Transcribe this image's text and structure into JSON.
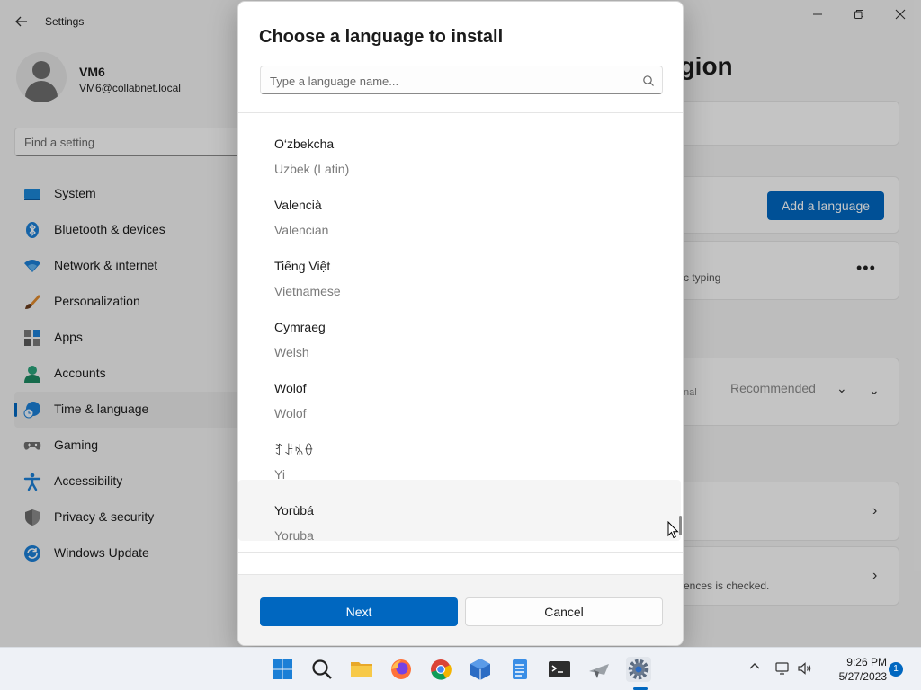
{
  "window": {
    "title": "Settings"
  },
  "profile": {
    "name": "VM6",
    "email": "VM6@collabnet.local"
  },
  "search": {
    "placeholder": "Find a setting"
  },
  "sidebar": {
    "items": [
      {
        "label": "System",
        "icon": "system-icon"
      },
      {
        "label": "Bluetooth & devices",
        "icon": "bluetooth-icon"
      },
      {
        "label": "Network & internet",
        "icon": "network-icon"
      },
      {
        "label": "Personalization",
        "icon": "brush-icon"
      },
      {
        "label": "Apps",
        "icon": "apps-icon"
      },
      {
        "label": "Accounts",
        "icon": "accounts-icon"
      },
      {
        "label": "Time & language",
        "icon": "time-language-icon",
        "active": true
      },
      {
        "label": "Gaming",
        "icon": "gaming-icon"
      },
      {
        "label": "Accessibility",
        "icon": "accessibility-icon"
      },
      {
        "label": "Privacy & security",
        "icon": "shield-icon"
      },
      {
        "label": "Windows Update",
        "icon": "update-icon"
      }
    ]
  },
  "main": {
    "title_fragment": "egion",
    "add_language_label": "Add a language",
    "typing_fragment": "c typing",
    "optional_fragment": "nal",
    "recommended_label": "Recommended",
    "checked_fragment": "ences is checked."
  },
  "dialog": {
    "title": "Choose a language to install",
    "search_placeholder": "Type a language name...",
    "languages": [
      {
        "native": "O‘zbekcha",
        "english": "Uzbek (Latin)"
      },
      {
        "native": "Valencià",
        "english": "Valencian"
      },
      {
        "native": "Tiếng Việt",
        "english": "Vietnamese"
      },
      {
        "native": "Cymraeg",
        "english": "Welsh"
      },
      {
        "native": "Wolof",
        "english": "Wolof"
      },
      {
        "native": "ꆈꌠꁱꂷ",
        "english": "Yi"
      },
      {
        "native": "Yorùbá",
        "english": "Yoruba"
      }
    ],
    "next_label": "Next",
    "cancel_label": "Cancel"
  },
  "taskbar": {
    "time": "9:26 PM",
    "date": "5/27/2023",
    "notification_count": "1",
    "accent": "#0067c0"
  }
}
